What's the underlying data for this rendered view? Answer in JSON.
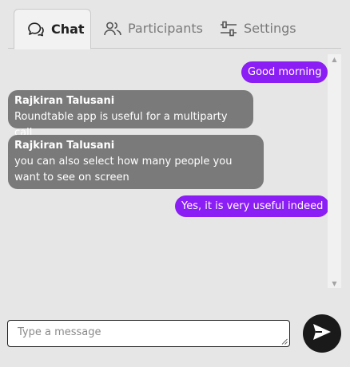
{
  "tabs": [
    {
      "label": "Chat",
      "icon": "chat-bubbles-icon",
      "active": true
    },
    {
      "label": "Participants",
      "icon": "people-icon",
      "active": false
    },
    {
      "label": "Settings",
      "icon": "sliders-icon",
      "active": false
    }
  ],
  "messages": [
    {
      "type": "self",
      "text": "Good morning"
    },
    {
      "type": "other",
      "sender": "Rajkiran Talusani",
      "text": "Roundtable app is useful for a multiparty call"
    },
    {
      "type": "other",
      "sender": "Rajkiran Talusani",
      "text": "you can also select how many people you want to see on screen"
    },
    {
      "type": "self",
      "text": "Yes, it is very useful indeed"
    }
  ],
  "composer": {
    "placeholder": "Type a message",
    "value": "",
    "send_icon": "send-icon"
  },
  "colors": {
    "self_bubble": "#8b1df5",
    "other_bubble": "#7a7a7a",
    "background": "#e6e6e6",
    "send_button": "#1a1a1a"
  }
}
